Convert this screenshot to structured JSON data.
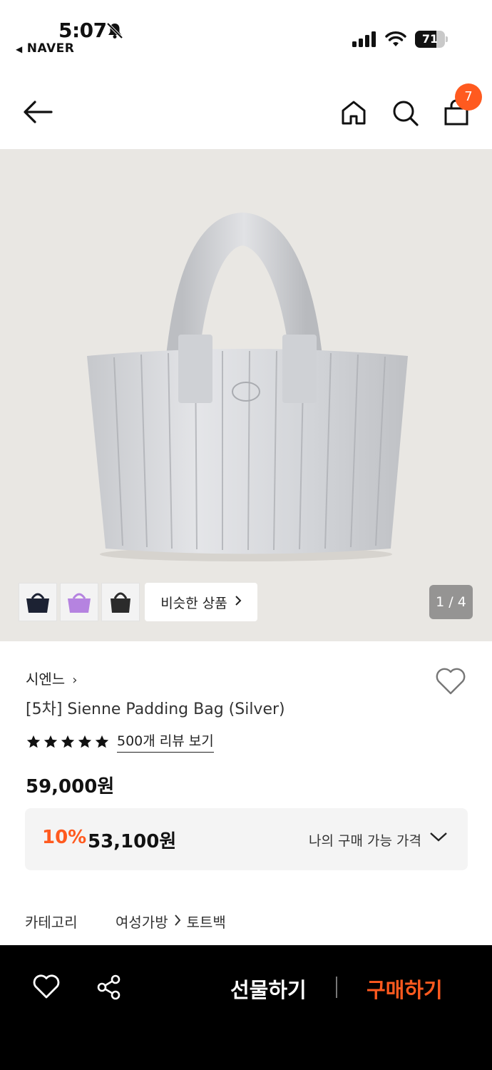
{
  "status_bar": {
    "time": "5:07",
    "back_app": "NAVER",
    "battery": "71",
    "battery_level": 0.71
  },
  "header": {
    "cart_count": "7"
  },
  "gallery": {
    "similar_label": "비슷한 상품",
    "pager": "1 / 4",
    "thumbnail_colors": [
      "#1c2233",
      "#b583e0",
      "#2b2b2b"
    ]
  },
  "product": {
    "brand": "시엔느",
    "title": "[5차] Sienne Padding Bag (Silver)",
    "rating_stars": 5,
    "review_link": "500개 리뷰 보기",
    "price": "59,000원",
    "discount_rate": "10%",
    "discount_price": "53,100원",
    "my_price_label": "나의 구매 가능 가격",
    "category_label": "카테고리",
    "category_path": [
      "여성가방",
      "토트백"
    ]
  },
  "bottom_bar": {
    "gift_label": "선물하기",
    "buy_label": "구매하기"
  },
  "colors": {
    "accent": "#ff5a1f",
    "hero_bg": "#e9e7e3"
  }
}
